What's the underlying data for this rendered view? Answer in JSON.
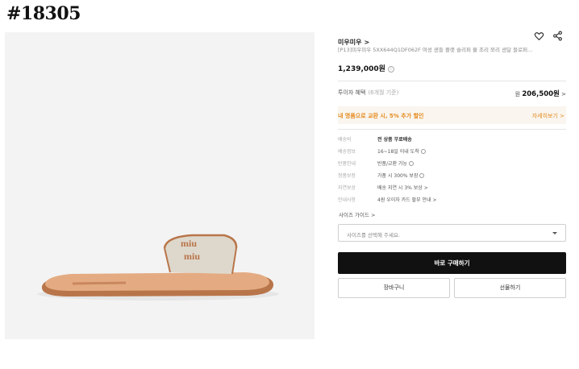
{
  "page_id": "#18305",
  "product": {
    "brand": "미우미우",
    "brand_chevron": ">",
    "title": "[P13]미우미우 5XX644Q1DF062F 여성 샌들 플랫 슬리퍼 뮬 조리 쪼리 샌달 블로퍼…",
    "price": "1,239,000원",
    "price_info_icon": "i",
    "logo_text": "MIU MIU"
  },
  "benefit": {
    "label": "투이자 혜택",
    "sub": "(6개월 기준)",
    "currency": "원",
    "amount": "206,500원",
    "chevron": ">"
  },
  "promo": {
    "text": "내 명품으로 교환 시, 5% 추가 할인",
    "link": "자세히보기 >"
  },
  "info_rows": [
    {
      "key": "배송비",
      "value": "전 상품 무료배송"
    },
    {
      "key": "배송정보",
      "value": "16~18일 이내 도착"
    },
    {
      "key": "반품안내",
      "value": "반품/교환 가능"
    },
    {
      "key": "정품보장",
      "value": "가품 시 300% 보장"
    },
    {
      "key": "지연보상",
      "value": "배송 지연 시 3% 보상 >"
    },
    {
      "key": "안내사항",
      "value": "4원 우이자 카드 할부 안내 >"
    }
  ],
  "size_guide": "사이즈 가이드 >",
  "size_select_placeholder": "사이즈를 선택해 주세요.",
  "buttons": {
    "buy": "바로 구매하기",
    "cart": "장바구니",
    "gift": "선물하기"
  }
}
